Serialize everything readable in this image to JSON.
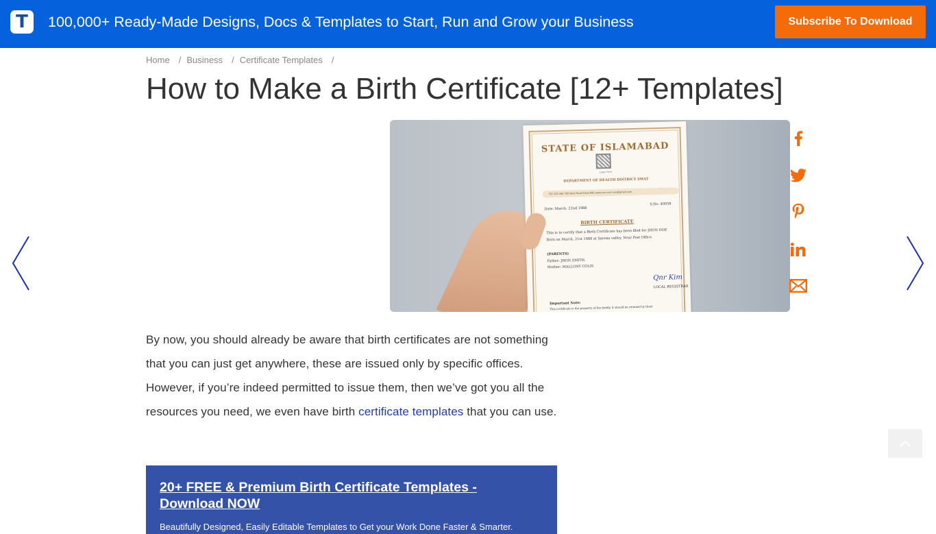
{
  "header": {
    "logo_letter": "T",
    "tagline": "100,000+ Ready-Made Designs, Docs & Templates to Start, Run and Grow your Business",
    "subscribe_label": "Subscribe To Download",
    "colors": {
      "bar": "#0562dc",
      "cta": "#f46b0a"
    }
  },
  "breadcrumb": {
    "items": [
      {
        "label": "Home"
      },
      {
        "label": "Business"
      },
      {
        "label": "Certificate Templates"
      }
    ],
    "separator": "/"
  },
  "article": {
    "title": "How to Make a Birth Certificate [12+ Templates]",
    "hero_image": {
      "alt": "Hand holding a birth certificate",
      "cert_title": "STATE OF ISLAMABAD",
      "cert_logo": "Logo Here",
      "cert_dept": "DEPARTMENT OF HEALTH DISTRICT SWAT",
      "cert_contact": "+92 123 456 789   New Road Swat 896   www.xxx.com   xxx@gmail.com",
      "cert_date": "Date: March, 22nd 1988",
      "cert_sno": "S.No. 40058",
      "cert_heading": "BIRTH CERTIFICATE",
      "cert_line1": "This is to certify that a Birth Certificate has been filed for JHON DOE",
      "cert_line2": "Born on March, 21st 1988 at Sarena valley, Near Post Office.",
      "cert_parents": "(PARENTS)",
      "cert_father": "Father: JHON SMITH.",
      "cert_mother": "Mother: MALLONY COLIS",
      "cert_signature": "Qnr Kim",
      "cert_registrar": "LOCAL REGISTRAR",
      "cert_note_title": "Important Note:",
      "cert_note": "This certificate is the property of the family, it should be retained by them"
    },
    "paragraph": {
      "before_link": "By now, you should already be aware that birth certificates are not something that you can just get anywhere, these are issued only by specific offices. However, if you’re indeed permitted to issue them, then we’ve got you all the resources you need, we even have birth ",
      "link_text": "certificate templates",
      "after_link": " that you can use."
    },
    "promo": {
      "title": "20+ FREE & Premium Birth Certificate Templates - Download NOW",
      "subtitle": "Beautifully Designed, Easily Editable Templates to Get your Work Done Faster & Smarter."
    }
  },
  "social": [
    {
      "name": "facebook",
      "icon": "facebook-icon"
    },
    {
      "name": "twitter",
      "icon": "twitter-icon"
    },
    {
      "name": "pinterest",
      "icon": "pinterest-icon"
    },
    {
      "name": "linkedin",
      "icon": "linkedin-icon"
    },
    {
      "name": "email",
      "icon": "email-icon"
    }
  ],
  "navigation": {
    "prev": "chevron-left-icon",
    "next": "chevron-right-icon",
    "back_to_top": "chevron-up-icon"
  }
}
